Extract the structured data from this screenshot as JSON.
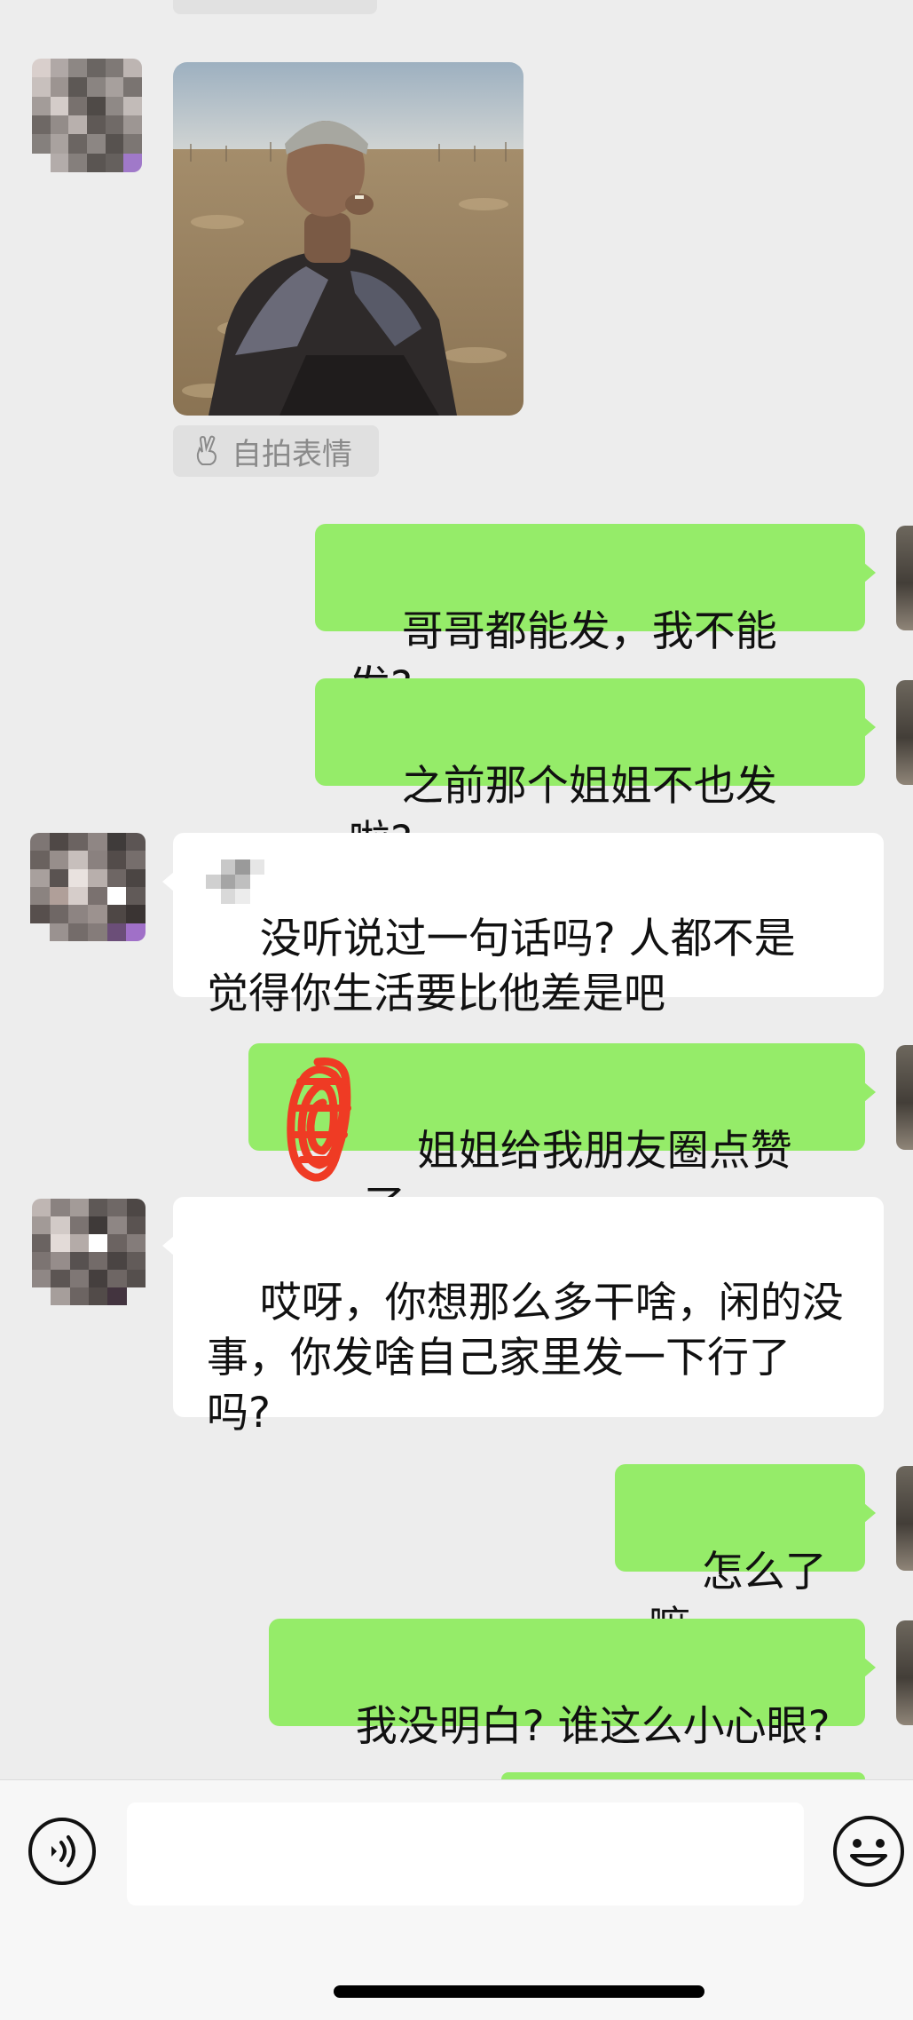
{
  "sticker": {
    "tag_label": "自拍表情",
    "tag_icon": "victory-hand-icon"
  },
  "messages": [
    {
      "side": "sent",
      "text": "哥哥都能发，我不能发?"
    },
    {
      "side": "sent",
      "text": "之前那个姐姐不也发啦?"
    },
    {
      "side": "received",
      "text": "没听说过一句话吗? 人都不是\n觉得你生活要比他差是吧"
    },
    {
      "side": "sent",
      "text": "姐姐给我朋友圈点赞了"
    },
    {
      "side": "received",
      "text": "哎呀，你想那么多干啥，闲的没\n事，你发啥自己家里发一下行了\n吗?"
    },
    {
      "side": "sent",
      "text": "怎么了嘛"
    },
    {
      "side": "sent",
      "text": "我没明白? 谁这么小心眼?"
    }
  ],
  "input": {
    "value": "",
    "voice_icon": "voice-icon",
    "emoji_icon": "emoji-icon"
  },
  "colors": {
    "background": "#ededed",
    "sent_bubble": "#95ec69",
    "received_bubble": "#ffffff",
    "toolbar": "#f7f7f7"
  }
}
